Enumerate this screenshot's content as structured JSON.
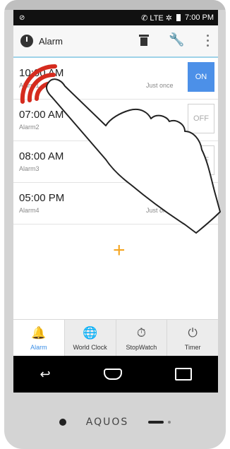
{
  "status": {
    "left": "⊘",
    "right_icons": "✆ LTE ✲",
    "time": "7:00 PM"
  },
  "appbar": {
    "title": "Alarm",
    "delete_icon": "trash-icon",
    "settings_icon": "wrench-icon",
    "menu_icon": "overflow-menu-icon"
  },
  "alarms": [
    {
      "time": "10:00 AM",
      "label": "Alarm1",
      "repeat": "Just once",
      "state": "ON",
      "enabled": true
    },
    {
      "time": "07:00 AM",
      "label": "Alarm2",
      "repeat": "",
      "state": "OFF",
      "enabled": false
    },
    {
      "time": "08:00 AM",
      "label": "Alarm3",
      "repeat": "",
      "state": "OFF",
      "enabled": false
    },
    {
      "time": "05:00 PM",
      "label": "Alarm4",
      "repeat": "Just once",
      "state": "OFF",
      "enabled": false
    }
  ],
  "add_button": "+",
  "tabs": [
    {
      "label": "Alarm",
      "icon": "bell-icon",
      "active": true
    },
    {
      "label": "World Clock",
      "icon": "globe-clock-icon",
      "active": false
    },
    {
      "label": "StopWatch",
      "icon": "stopwatch-icon",
      "active": false
    },
    {
      "label": "Timer",
      "icon": "timer-icon",
      "active": false
    }
  ],
  "device": {
    "brand": "AQUOS"
  },
  "colors": {
    "accent": "#4c90e8",
    "add": "#f5a623",
    "tab_active": "#3a8ee6",
    "tap_ring": "#d52b1e"
  }
}
